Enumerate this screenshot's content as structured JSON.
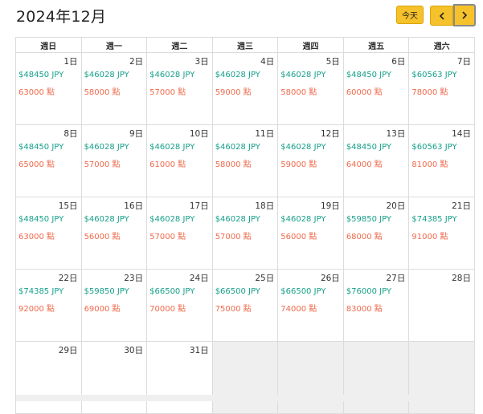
{
  "header": {
    "title": "2024年12月",
    "today_label": "今天",
    "prev_icon": "chevron-left-icon",
    "next_icon": "chevron-right-icon"
  },
  "colors": {
    "accent": "#f6c22b",
    "price": "#17a08a",
    "points": "#ef6a4c",
    "empty_cell": "#efefef"
  },
  "weekdays": [
    "週日",
    "週一",
    "週二",
    "週三",
    "週四",
    "週五",
    "週六"
  ],
  "weeks": [
    [
      {
        "day": "1日",
        "price": "$48450 JPY",
        "points": "63000 點"
      },
      {
        "day": "2日",
        "price": "$46028 JPY",
        "points": "58000 點"
      },
      {
        "day": "3日",
        "price": "$46028 JPY",
        "points": "57000 點"
      },
      {
        "day": "4日",
        "price": "$46028 JPY",
        "points": "59000 點"
      },
      {
        "day": "5日",
        "price": "$46028 JPY",
        "points": "58000 點"
      },
      {
        "day": "6日",
        "price": "$48450 JPY",
        "points": "60000 點"
      },
      {
        "day": "7日",
        "price": "$60563 JPY",
        "points": "78000 點"
      }
    ],
    [
      {
        "day": "8日",
        "price": "$48450 JPY",
        "points": "65000 點"
      },
      {
        "day": "9日",
        "price": "$46028 JPY",
        "points": "57000 點"
      },
      {
        "day": "10日",
        "price": "$46028 JPY",
        "points": "61000 點"
      },
      {
        "day": "11日",
        "price": "$46028 JPY",
        "points": "58000 點"
      },
      {
        "day": "12日",
        "price": "$46028 JPY",
        "points": "59000 點"
      },
      {
        "day": "13日",
        "price": "$48450 JPY",
        "points": "64000 點"
      },
      {
        "day": "14日",
        "price": "$60563 JPY",
        "points": "81000 點"
      }
    ],
    [
      {
        "day": "15日",
        "price": "$48450 JPY",
        "points": "63000 點"
      },
      {
        "day": "16日",
        "price": "$46028 JPY",
        "points": "56000 點"
      },
      {
        "day": "17日",
        "price": "$46028 JPY",
        "points": "57000 點"
      },
      {
        "day": "18日",
        "price": "$46028 JPY",
        "points": "57000 點"
      },
      {
        "day": "19日",
        "price": "$46028 JPY",
        "points": "56000 點"
      },
      {
        "day": "20日",
        "price": "$59850 JPY",
        "points": "68000 點"
      },
      {
        "day": "21日",
        "price": "$74385 JPY",
        "points": "91000 點"
      }
    ],
    [
      {
        "day": "22日",
        "price": "$74385 JPY",
        "points": "92000 點"
      },
      {
        "day": "23日",
        "price": "$59850 JPY",
        "points": "69000 點"
      },
      {
        "day": "24日",
        "price": "$66500 JPY",
        "points": "70000 點"
      },
      {
        "day": "25日",
        "price": "$66500 JPY",
        "points": "75000 點"
      },
      {
        "day": "26日",
        "price": "$66500 JPY",
        "points": "74000 點"
      },
      {
        "day": "27日",
        "price": "$76000 JPY",
        "points": "83000 點"
      },
      {
        "day": "28日",
        "price": "",
        "points": ""
      }
    ],
    [
      {
        "day": "29日",
        "price": "",
        "points": ""
      },
      {
        "day": "30日",
        "price": "",
        "points": ""
      },
      {
        "day": "31日",
        "price": "",
        "points": ""
      },
      {
        "day": "",
        "price": "",
        "points": "",
        "empty": true
      },
      {
        "day": "",
        "price": "",
        "points": "",
        "empty": true
      },
      {
        "day": "",
        "price": "",
        "points": "",
        "empty": true
      },
      {
        "day": "",
        "price": "",
        "points": "",
        "empty": true
      }
    ]
  ]
}
